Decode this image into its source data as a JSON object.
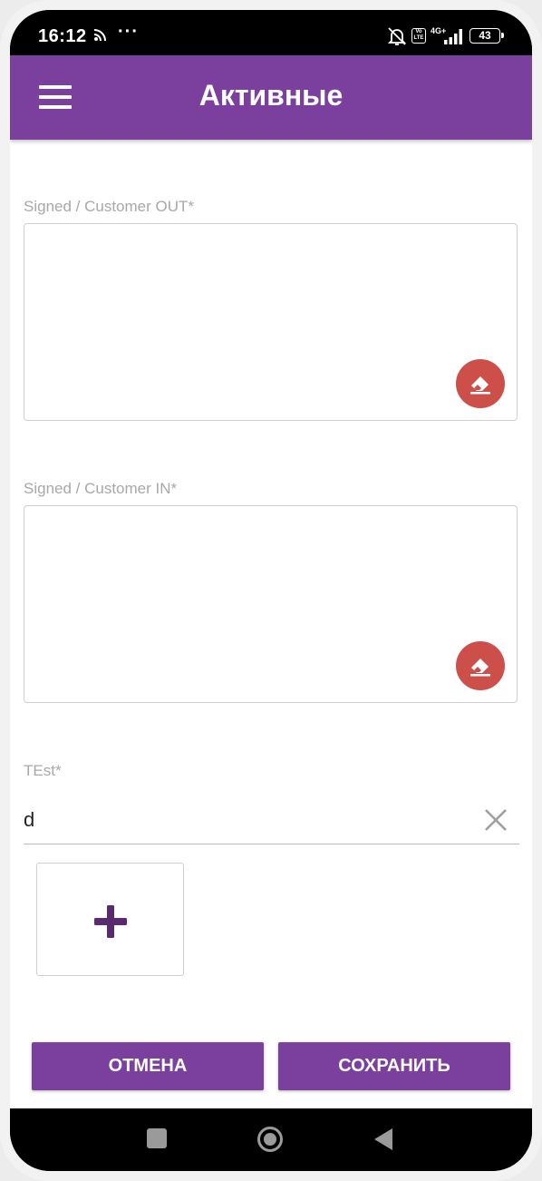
{
  "status_bar": {
    "time": "16:12",
    "volte_label": "Vo LTE",
    "network": "4G+",
    "battery": "43"
  },
  "app_bar": {
    "title": "Активные"
  },
  "form": {
    "signature_out_label": "Signed / Customer OUT*",
    "signature_in_label": "Signed / Customer IN*",
    "test_label": "TEst*",
    "test_value": "d"
  },
  "buttons": {
    "cancel": "ОТМЕНА",
    "save": "СОХРАНИТЬ"
  },
  "colors": {
    "primary": "#7b3f9e",
    "erase": "#cc4f4a",
    "plus_icon": "#5a2a6e"
  }
}
